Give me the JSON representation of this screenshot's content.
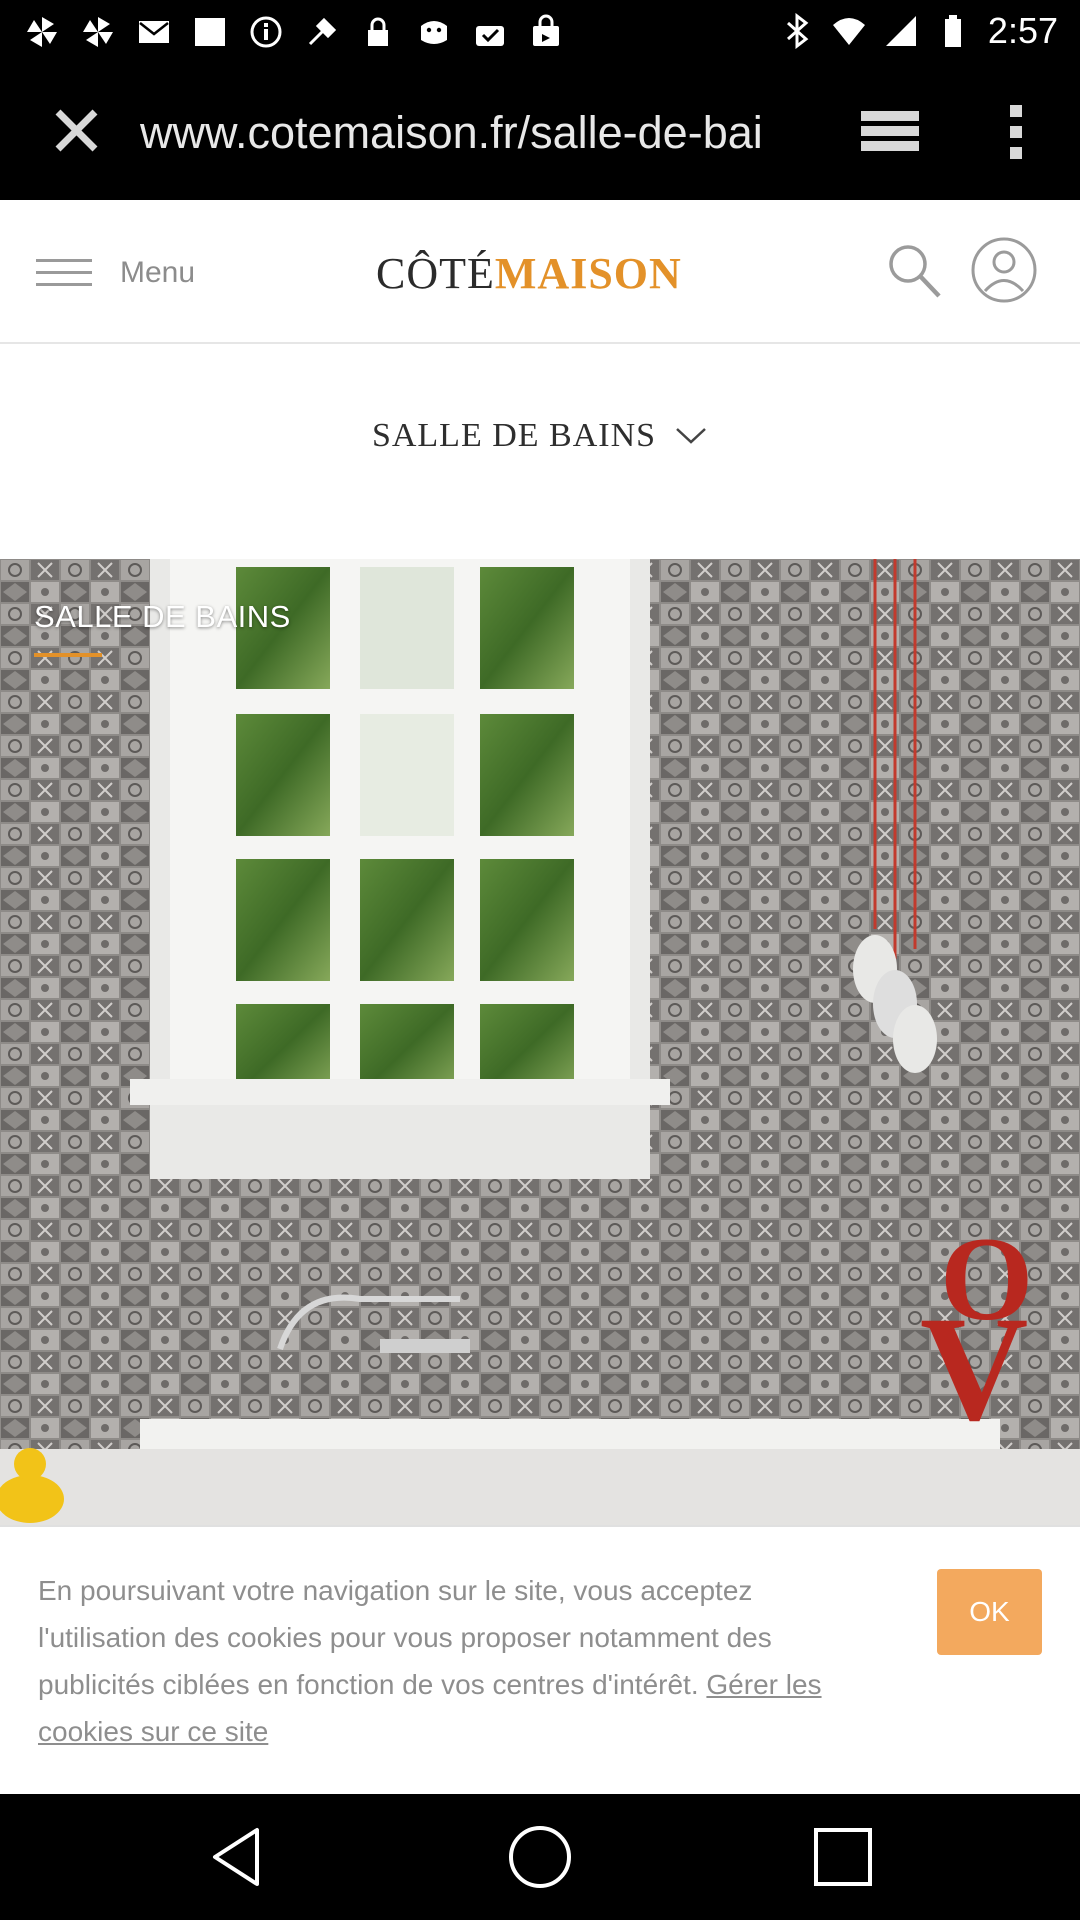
{
  "status_bar": {
    "time": "2:57",
    "left_icons": [
      "pinwheel-icon",
      "pinwheel-icon",
      "email-icon",
      "image-icon",
      "info-icon",
      "fake-gps-icon",
      "lock-icon",
      "bag-icon",
      "bag-check-icon",
      "shopping-bag-icon"
    ],
    "right_icons": [
      "bluetooth-icon",
      "wifi-icon",
      "signal-icon",
      "battery-icon"
    ]
  },
  "browser": {
    "url": "www.cotemaison.fr/salle-de-bai",
    "load_progress": 0.86,
    "accent_color": "#29a3e3"
  },
  "site": {
    "menu_label": "Menu",
    "logo_part1": "CÔTÉ",
    "logo_part2": "MAISON",
    "brand_color": "#e39129",
    "section_title": "SALLE DE BAINS"
  },
  "hero": {
    "label": "SALLE DE BAINS",
    "image_description_icon": "bathroom-photo"
  },
  "cookie_banner": {
    "text": "En poursuivant votre navigation sur le site, vous acceptez l'utilisation des cookies pour vous proposer notamment des publicités ciblées en fonction de vos centres d'intérêt.",
    "link_text": "Gérer les cookies sur ce site",
    "ok_label": "OK",
    "ok_color": "#f3a95e"
  },
  "nav_bar": {
    "buttons": [
      "back-icon",
      "home-icon",
      "recents-icon"
    ]
  }
}
